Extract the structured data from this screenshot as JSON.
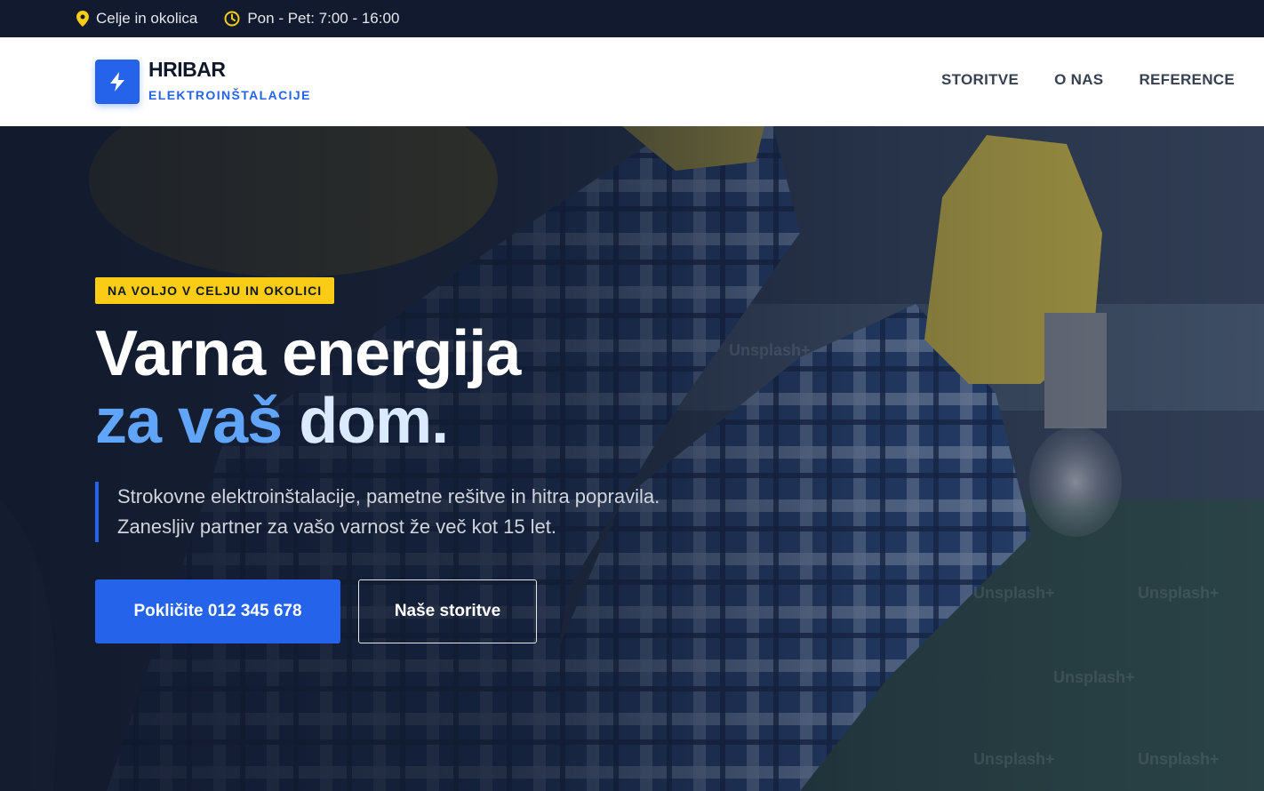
{
  "topbar": {
    "location": "Celje in okolica",
    "hours": "Pon - Pet: 7:00 - 16:00"
  },
  "header": {
    "brand_name": "HRIBAR",
    "brand_sub": "ELEKTROINŠTALACIJE",
    "nav": [
      "STORITVE",
      "O NAS",
      "REFERENCE"
    ]
  },
  "hero": {
    "badge": "NA VOLJO V CELJU IN OKOLICI",
    "headline_line1": "Varna energija",
    "headline_blue": "za vaš",
    "headline_light": "dom.",
    "lead_line1": "Strokovne elektroinštalacije, pametne rešitve in hitra popravila.",
    "lead_line2": "Zanesljiv partner za vašo varnost že več kot 15 let.",
    "cta_primary": "Pokličite 012 345 678",
    "cta_secondary": "Naše storitve",
    "watermark": "Unsplash+"
  },
  "colors": {
    "accent": "#2563eb",
    "badge": "#facc15",
    "topbar": "#111a2e",
    "headline_blue": "#60a5fa"
  }
}
